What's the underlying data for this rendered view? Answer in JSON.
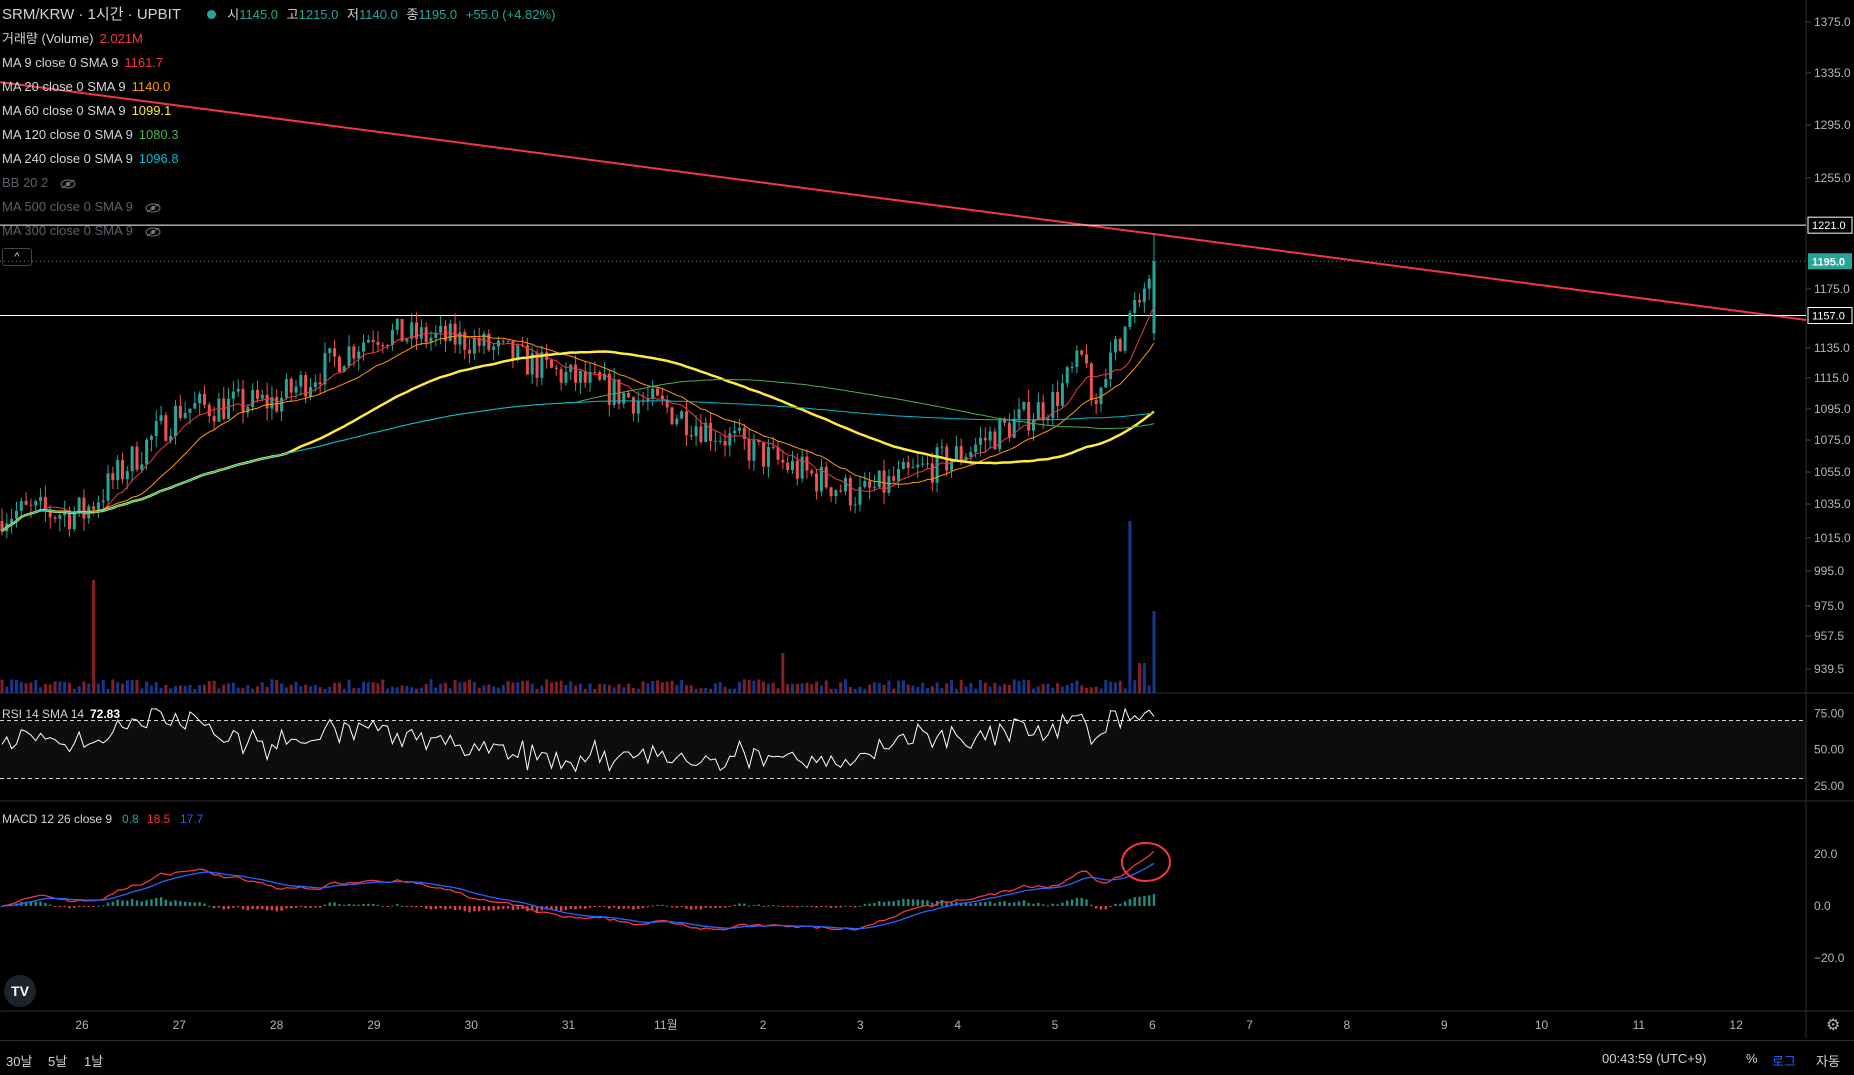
{
  "header": {
    "symbol": "SRM/KRW · 1시간 · UPBIT",
    "ohlc": [
      {
        "label": "시",
        "value": "1145.0"
      },
      {
        "label": "고",
        "value": "1215.0"
      },
      {
        "label": "저",
        "value": "1140.0"
      },
      {
        "label": "종",
        "value": "1195.0"
      }
    ],
    "change": "+55.0 (+4.82%)"
  },
  "legend": [
    {
      "label": "거래량 (Volume)",
      "value": "2.021M",
      "color": "#f23645",
      "hidden": false
    },
    {
      "label": "MA 9 close 0 SMA 9",
      "value": "1161.7",
      "color": "#f23645",
      "hidden": false
    },
    {
      "label": "MA 20 close 0 SMA 9",
      "value": "1140.0",
      "color": "#ff9800",
      "hidden": false
    },
    {
      "label": "MA 60 close 0 SMA 9",
      "value": "1099.1",
      "color": "#ffeb3b",
      "hidden": false
    },
    {
      "label": "MA 120 close 0 SMA 9",
      "value": "1080.3",
      "color": "#4caf50",
      "hidden": false
    },
    {
      "label": "MA 240 close 0 SMA 9",
      "value": "1096.8",
      "color": "#00bcd4",
      "hidden": false
    },
    {
      "label": "BB 20 2",
      "value": "",
      "color": "#5d606b",
      "hidden": true
    },
    {
      "label": "MA 500 close 0 SMA 9",
      "value": "",
      "color": "#5d606b",
      "hidden": true
    },
    {
      "label": "MA 300 close 0 SMA 9",
      "value": "",
      "color": "#5d606b",
      "hidden": true
    }
  ],
  "collapse_label": "^",
  "price_axis": {
    "ticks": [
      "1375.0",
      "1335.0",
      "1295.0",
      "1255.0",
      "1175.0",
      "1135.0",
      "1115.0",
      "1095.0",
      "1075.0",
      "1055.0",
      "1035.0",
      "1015.0",
      "995.0",
      "975.0",
      "957.5",
      "939.5"
    ],
    "tick_values": [
      1375,
      1335,
      1295,
      1255,
      1175,
      1135,
      1115,
      1095,
      1075,
      1055,
      1035,
      1015,
      995,
      975,
      957.5,
      939.5
    ],
    "hline_labels": [
      "1221.0",
      "1157.0"
    ],
    "hline_values": [
      1221,
      1157
    ],
    "current_price": "1195.0",
    "current_value": 1195,
    "current_color": "#26a69a"
  },
  "rsi": {
    "label": "RSI 14 SMA 14",
    "value": "72.83",
    "ticks": [
      "75.00",
      "50.00",
      "25.00"
    ],
    "upper": 70,
    "lower": 30
  },
  "macd": {
    "label": "MACD 12 26 close 9",
    "hist": "0.8",
    "macd": "18.5",
    "signal": "17.7",
    "ticks": [
      "20.0",
      "0.0",
      "−20.0"
    ],
    "tick_values": [
      20,
      0,
      -20
    ]
  },
  "time_axis": {
    "labels": [
      "26",
      "27",
      "28",
      "29",
      "30",
      "31",
      "11월",
      "2",
      "3",
      "4",
      "5",
      "6",
      "7",
      "8",
      "9",
      "10",
      "11",
      "12"
    ]
  },
  "bottom_bar": {
    "ranges": [
      "30날",
      "5날",
      "1날"
    ],
    "time": "00:43:59 (UTC+9)",
    "percent": "%",
    "log": "로그",
    "auto": "자동"
  },
  "logo_text": "TV",
  "colors": {
    "up": "#26a69a",
    "down": "#ef5350",
    "trendline": "#f23645"
  },
  "chart_data": {
    "type": "candlestick",
    "note_series": [
      "price",
      "volume",
      "rsi",
      "macd"
    ],
    "price_anchors": {
      "x": [
        "26",
        "27",
        "28",
        "29",
        "30",
        "31",
        "11월",
        "2",
        "3",
        "4",
        "5",
        "6"
      ],
      "close": [
        1030,
        1095,
        1100,
        1145,
        1140,
        1115,
        1095,
        1065,
        1040,
        1065,
        1100,
        1195
      ]
    },
    "last_candle": {
      "open": 1145.0,
      "high": 1215.0,
      "low": 1140.0,
      "close": 1195.0
    },
    "ma9_last": 1161.7,
    "ma20_last": 1140.0,
    "ma60_last": 1099.1,
    "ma120_last": 1080.3,
    "ma240_last": 1096.8,
    "volume_last": "2.021M",
    "rsi_last": 72.83,
    "macd_last": {
      "hist": 0.8,
      "macd": 18.5,
      "signal": 17.7
    }
  }
}
